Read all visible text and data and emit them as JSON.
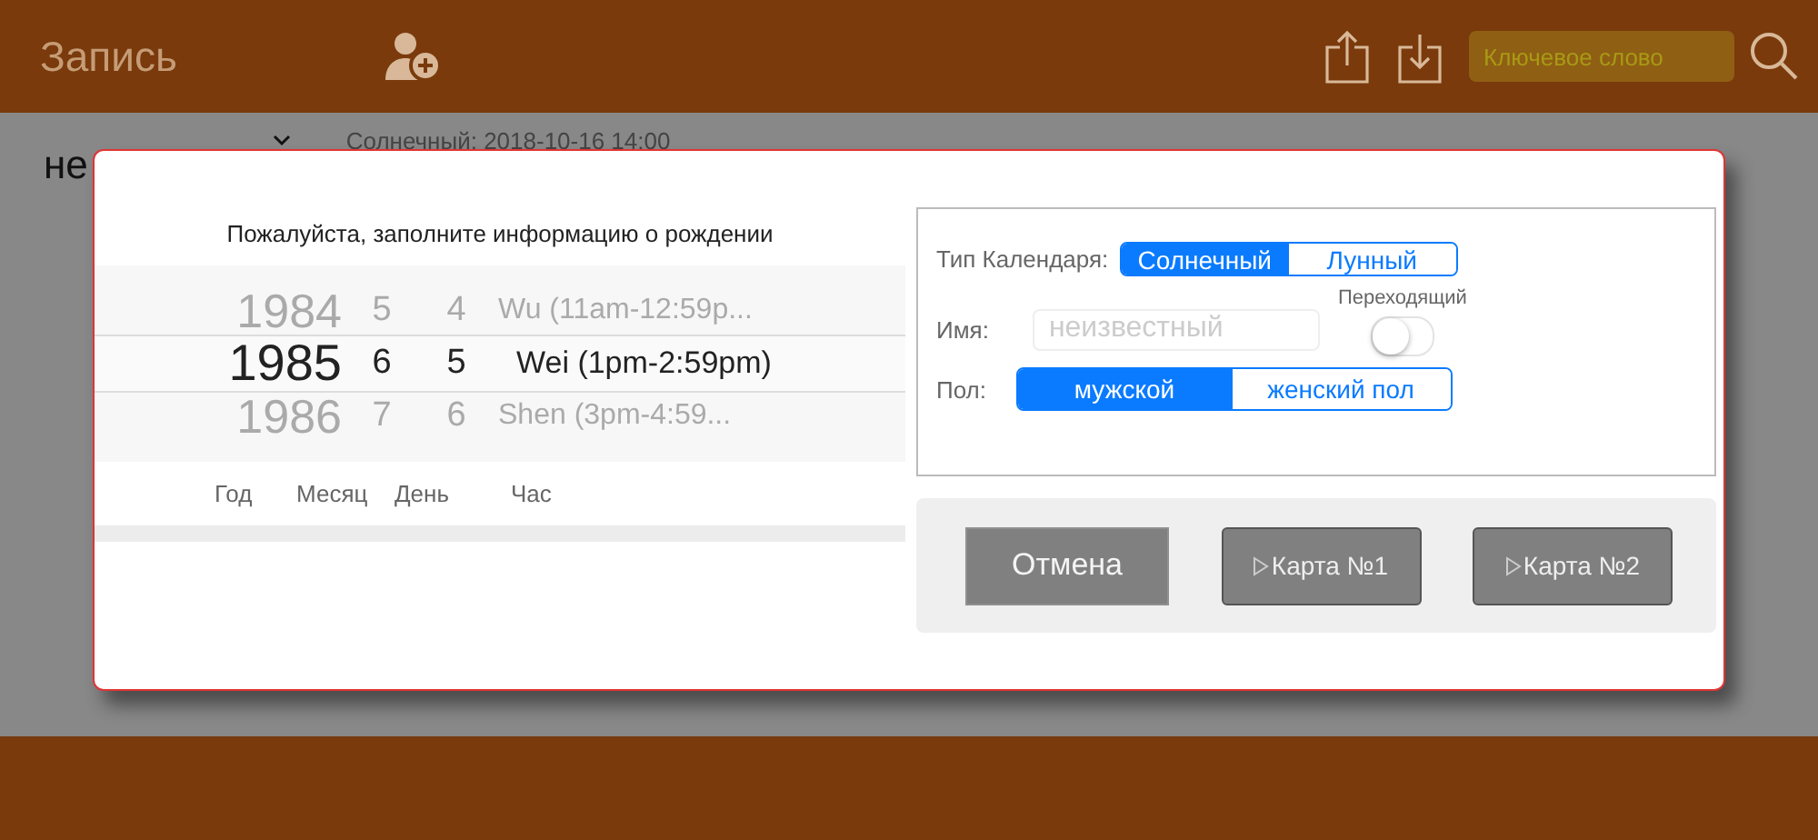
{
  "header": {
    "title": "Запись",
    "search": {
      "placeholder": "Ключевое слово"
    }
  },
  "background": {
    "name_value": "не",
    "date_text": "Солнечный: 2018-10-16 14:00"
  },
  "dialog": {
    "prompt": "Пожалуйста, заполните информацию о рождении",
    "picker_rows": [
      {
        "year": "1984",
        "month": "5",
        "day": "4",
        "hour": "Wu (11am-12:59p...",
        "selected": false
      },
      {
        "year": "1985",
        "month": "6",
        "day": "5",
        "hour": "Wei (1pm-2:59pm)",
        "selected": true
      },
      {
        "year": "1986",
        "month": "7",
        "day": "6",
        "hour": "Shen (3pm-4:59...",
        "selected": false
      }
    ],
    "picker_labels": [
      "Год",
      "Месяц",
      "День",
      "Час"
    ],
    "calendar": {
      "label": "Тип Календаря:",
      "options": [
        {
          "label": "Солнечный",
          "selected": true
        },
        {
          "label": "Лунный",
          "selected": false
        }
      ]
    },
    "name": {
      "label": "Имя:",
      "placeholder": "неизвестный"
    },
    "leap": {
      "label": "Переходящий",
      "on": false
    },
    "gender": {
      "label": "Пол:",
      "options": [
        {
          "label": "мужской",
          "selected": true
        },
        {
          "label": "женский пол",
          "selected": false
        }
      ]
    },
    "buttons": [
      {
        "kind": "plain",
        "label": "Отмена"
      },
      {
        "kind": "card",
        "label": "Карта №1"
      },
      {
        "kind": "card",
        "label": "Карта №2"
      }
    ]
  }
}
